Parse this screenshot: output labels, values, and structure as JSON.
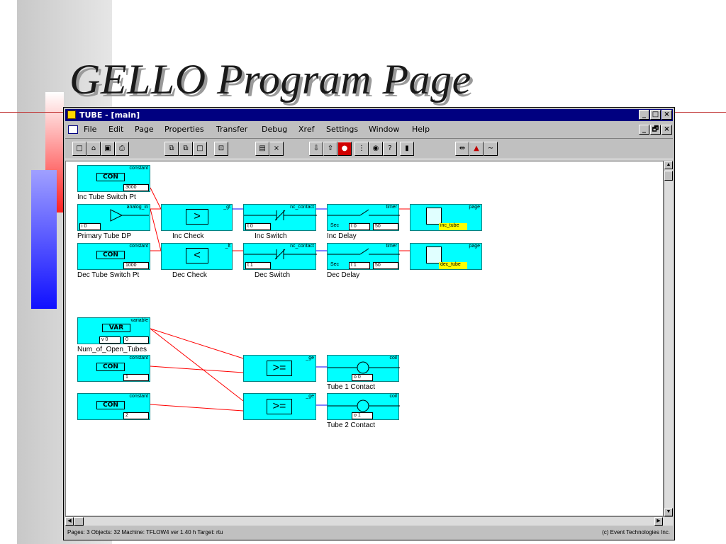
{
  "slide": {
    "title": "GELLO Program Page"
  },
  "window": {
    "title": "TUBE - [main]",
    "caption_buttons": [
      "_",
      "□",
      "×"
    ],
    "mdi_buttons": [
      "_",
      "🗗",
      "×"
    ]
  },
  "menu": [
    "File",
    "Edit",
    "Page",
    "Properties",
    "Transfer",
    "Debug",
    "Xref",
    "Settings",
    "Window",
    "Help"
  ],
  "status": {
    "left": "Pages: 3  Objects: 32  Machine: TFLOW4 ver 1.40 h  Target: rtu",
    "right": "(c) Event Technologies Inc."
  },
  "blocks": {
    "c1": {
      "type": "constant",
      "tag": "CON",
      "value": "3000",
      "label": "Inc Tube Switch Pt"
    },
    "ai": {
      "type": "analog_in",
      "value": "i 0",
      "label": "Primary Tube DP"
    },
    "c2": {
      "type": "constant",
      "tag": "CON",
      "value": "1000",
      "label": "Dec Tube Switch Pt"
    },
    "gt": {
      "type": "_gt",
      "symbol": ">",
      "label": "Inc Check"
    },
    "lt": {
      "type": "_lt",
      "symbol": "<",
      "label": "Dec Check"
    },
    "nc1": {
      "type": "nc_contact",
      "value": "t 0",
      "label": "Inc Switch"
    },
    "nc2": {
      "type": "nc_contact",
      "value": "t 1",
      "label": "Dec Switch"
    },
    "tm1": {
      "type": "timer",
      "unit": "Sec",
      "tag": "t 0",
      "value": "50",
      "label": "Inc Delay"
    },
    "tm2": {
      "type": "timer",
      "unit": "Sec",
      "tag": "t 1",
      "value": "50",
      "label": "Dec Delay"
    },
    "pg1": {
      "type": "page",
      "name": "inc_tube"
    },
    "pg2": {
      "type": "page",
      "name": "dec_tube"
    },
    "var": {
      "type": "variable",
      "tag": "VAR",
      "name": "v 0",
      "value": "0",
      "label": "Num_of_Open_Tubes"
    },
    "c3": {
      "type": "constant",
      "tag": "CON",
      "value": "1"
    },
    "c4": {
      "type": "constant",
      "tag": "CON",
      "value": "2"
    },
    "ge1": {
      "type": "_ge",
      "symbol": ">="
    },
    "ge2": {
      "type": "_ge",
      "symbol": ">="
    },
    "coil1": {
      "type": "coil",
      "tag": "o 0",
      "label": "Tube 1 Contact"
    },
    "coil2": {
      "type": "coil",
      "tag": "o 1",
      "label": "Tube 2 Contact"
    }
  },
  "colors": {
    "block": "#00ffff",
    "wire": "#ff0000",
    "link": "#0000ff",
    "titlebar": "#000080",
    "highlight": "#ffff00"
  }
}
